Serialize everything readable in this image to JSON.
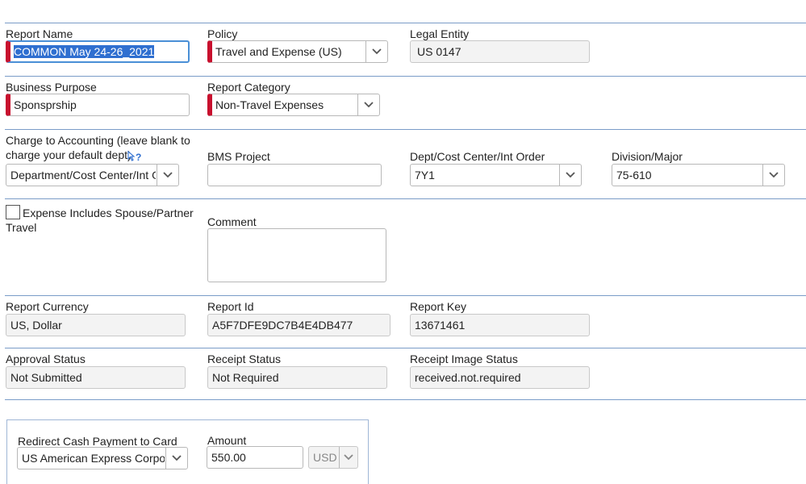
{
  "fields": {
    "report_name": {
      "label": "Report Name",
      "value_selected": "COMMON May 24-26_2021"
    },
    "policy": {
      "label": "Policy",
      "value": "Travel and Expense (US)"
    },
    "legal_entity": {
      "label": "Legal Entity",
      "value": "US 0147"
    },
    "business_purpose": {
      "label": "Business Purpose",
      "value": "Sponsprship"
    },
    "report_category": {
      "label": "Report Category",
      "value": "Non-Travel Expenses"
    },
    "charge_to_accounting": {
      "label_line1": "Charge to Accounting (leave blank to",
      "label_line2": "charge your default dept)",
      "value": "Department/Cost Center/Int Or"
    },
    "bms_project": {
      "label": "BMS Project",
      "value": ""
    },
    "dept_cost_center": {
      "label": "Dept/Cost Center/Int Order",
      "value": "7Y1"
    },
    "division_major": {
      "label": "Division/Major",
      "value": "75-610"
    },
    "spouse_travel": {
      "label_line1": "Expense Includes Spouse/Partner",
      "label_line2": "Travel",
      "checked": false
    },
    "comment": {
      "label": "Comment",
      "value": ""
    },
    "report_currency": {
      "label": "Report Currency",
      "value": "US, Dollar"
    },
    "report_id": {
      "label": "Report Id",
      "value": "A5F7DFE9DC7B4E4DB477"
    },
    "report_key": {
      "label": "Report Key",
      "value": "13671461"
    },
    "approval_status": {
      "label": "Approval Status",
      "value": "Not Submitted"
    },
    "receipt_status": {
      "label": "Receipt Status",
      "value": "Not Required"
    },
    "receipt_image_status": {
      "label": "Receipt Image Status",
      "value": "received.not.required"
    },
    "redirect_cash": {
      "label": "Redirect Cash Payment to Card",
      "value": "US American Express Corpor"
    },
    "amount": {
      "label": "Amount",
      "value": "550.00",
      "currency": "USD"
    }
  },
  "icons": {
    "help": "help-question-icon",
    "dropdown": "chevron-down-icon"
  },
  "colors": {
    "required": "#c8102e",
    "divider": "#7a9cc8",
    "focus": "#4a8fd6",
    "selection": "#2f6fd0"
  }
}
